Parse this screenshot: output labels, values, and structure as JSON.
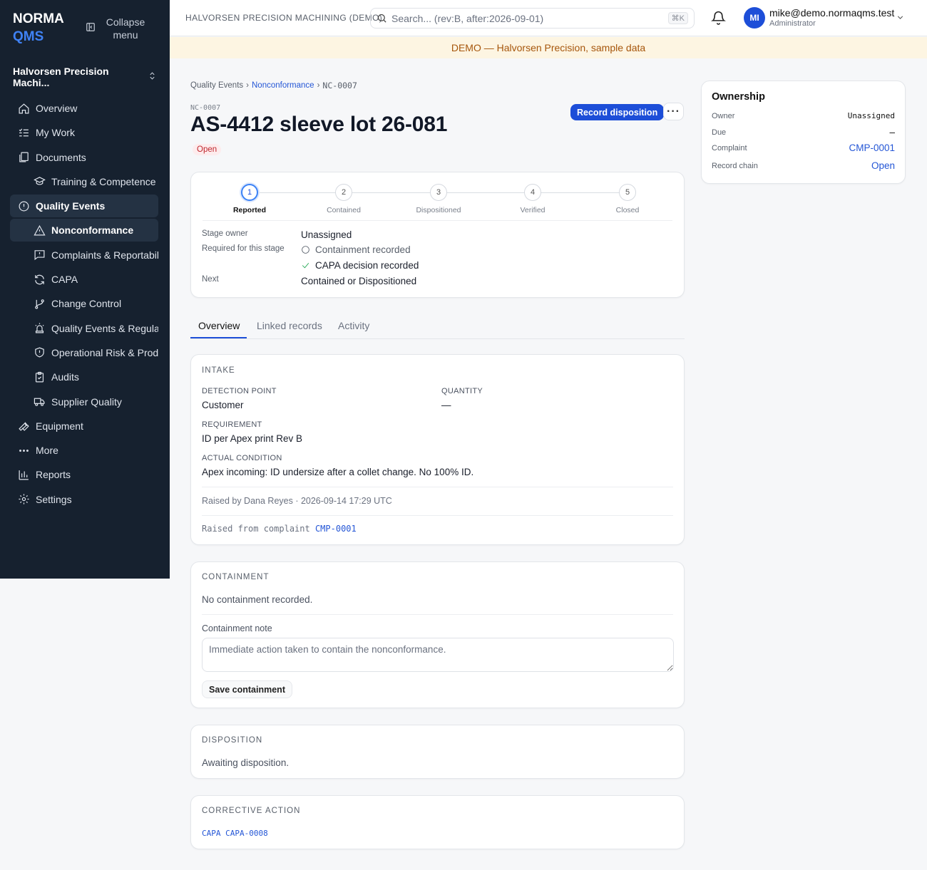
{
  "app": {
    "logo_line1": "NORMA",
    "logo_line2": "QMS",
    "collapse_label": "Collapse menu",
    "org_name": "Halvorsen Precision Machi..."
  },
  "sidebar": {
    "items": [
      {
        "label": "Overview",
        "icon": "home-icon"
      },
      {
        "label": "My Work",
        "icon": "list-check-icon"
      },
      {
        "label": "Documents",
        "icon": "documents-icon"
      },
      {
        "label": "Training & Competence",
        "icon": "graduation-cap-icon"
      },
      {
        "label": "Quality Events",
        "icon": "alert-circle-icon"
      },
      {
        "label": "Nonconformance",
        "icon": "warning-triangle-icon"
      },
      {
        "label": "Complaints & Reportability",
        "icon": "message-alert-icon"
      },
      {
        "label": "CAPA",
        "icon": "refresh-icon"
      },
      {
        "label": "Change Control",
        "icon": "git-branch-icon"
      },
      {
        "label": "Quality Events & Regulatory",
        "icon": "siren-icon"
      },
      {
        "label": "Operational Risk & Product",
        "icon": "shield-icon"
      },
      {
        "label": "Audits",
        "icon": "clipboard-check-icon"
      },
      {
        "label": "Supplier Quality",
        "icon": "truck-icon"
      },
      {
        "label": "Equipment",
        "icon": "wrench-icon"
      },
      {
        "label": "More",
        "icon": "more-dots-icon"
      },
      {
        "label": "Reports",
        "icon": "bar-chart-icon"
      },
      {
        "label": "Settings",
        "icon": "gear-icon"
      }
    ]
  },
  "topbar": {
    "org": "HALVORSEN PRECISION MACHINING (DEMO)",
    "search_placeholder": "Search... (rev:B, after:2026-09-01)",
    "search_shortcut": "⌘K",
    "avatar_initials": "MI",
    "user_email": "mike@demo.normaqms.test",
    "user_role": "Administrator"
  },
  "banner": "DEMO — Halvorsen Precision, sample data",
  "record": {
    "breadcrumb": [
      "Quality Events",
      "Nonconformance",
      "NC-0007"
    ],
    "id": "NC-0007",
    "title": "AS-4412 sleeve lot 26-081",
    "status": "Open",
    "primary_action": "Record disposition",
    "more_label": "···"
  },
  "stepper": {
    "steps": [
      {
        "num": "1",
        "label": "Reported"
      },
      {
        "num": "2",
        "label": "Contained"
      },
      {
        "num": "3",
        "label": "Dispositioned"
      },
      {
        "num": "4",
        "label": "Verified"
      },
      {
        "num": "5",
        "label": "Closed"
      }
    ],
    "current_step": 1,
    "stage_owner_label": "Stage owner",
    "stage_owner": "Unassigned",
    "required_label": "Required for this stage",
    "requirements": [
      {
        "text": "Containment recorded",
        "done": false
      },
      {
        "text": "CAPA decision recorded",
        "done": true
      }
    ],
    "next_label": "Next",
    "next": "Contained or Dispositioned"
  },
  "tabs": [
    "Overview",
    "Linked records",
    "Activity"
  ],
  "intake": {
    "heading": "INTAKE",
    "detection_point_label": "DETECTION POINT",
    "detection_point": "Customer",
    "quantity_label": "QUANTITY",
    "quantity": "—",
    "requirement_label": "REQUIREMENT",
    "requirement": "ID per Apex print Rev B",
    "actual_condition_label": "ACTUAL CONDITION",
    "actual_condition": "Apex incoming: ID undersize after a collet change. No 100% ID.",
    "raised_by": "Raised by Dana Reyes · 2026-09-14 17:29 UTC",
    "raised_from_prefix": "Raised from complaint",
    "raised_from_link": "CMP-0001"
  },
  "containment": {
    "heading": "CONTAINMENT",
    "empty": "No containment recorded.",
    "note_label": "Containment note",
    "note_placeholder": "Immediate action taken to contain the nonconformance.",
    "save_label": "Save containment"
  },
  "disposition": {
    "heading": "DISPOSITION",
    "text": "Awaiting disposition."
  },
  "corrective_action": {
    "heading": "CORRECTIVE ACTION",
    "prefix": "CAPA",
    "link": "CAPA-0008"
  },
  "ownership": {
    "heading": "Ownership",
    "owner_label": "Owner",
    "owner": "Unassigned",
    "due_label": "Due",
    "due": "–",
    "complaint_label": "Complaint",
    "complaint": "CMP-0001",
    "chain_label": "Record chain",
    "chain": "Open"
  },
  "colors": {
    "sidebar_bg": "#16212f",
    "accent": "#1d4ed8",
    "banner_bg": "#fdf5e2",
    "status_open": "#c0262d"
  }
}
